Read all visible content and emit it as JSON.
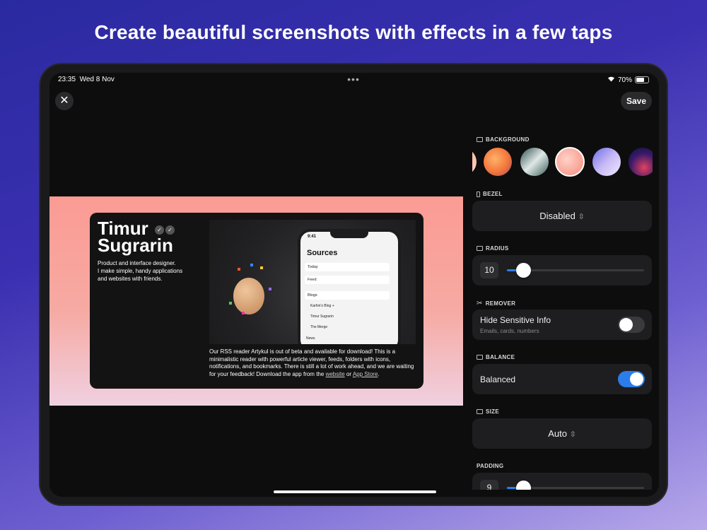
{
  "headline": "Create beautiful screenshots with effects in a few taps",
  "status_bar": {
    "time": "23:35",
    "date": "Wed 8 Nov",
    "battery": "70%",
    "battery_level": 0.7
  },
  "toolbar": {
    "close_icon": "close-icon",
    "save_label": "Save"
  },
  "card": {
    "title_line1": "Timur",
    "title_line2": "Sugrarin",
    "desc_line1": "Product and interface designer.",
    "desc_line2": "I make simple, handy applications",
    "desc_line3": "and websites with friends.",
    "body_text": "Our RSS reader Artykul is out of beta and available for download! This is a minimalistic reader with powerful article viewer, feeds, folders with icons, notifications, and bookmarks. There is still a lot of work ahead, and we are waiting for your feedback! Download the app from the",
    "link_website": "website",
    "or_text": "or",
    "link_appstore": "App Store",
    "period": "."
  },
  "phone": {
    "time": "9:41",
    "title": "Sources",
    "rows": [
      "Today",
      "Feed",
      "Blogs"
    ],
    "sub_rows": [
      "Karhin's Blog +",
      "Timur Sugrarin",
      "The Merge"
    ],
    "next_row": "News"
  },
  "panel": {
    "background": {
      "label": "BACKGROUND",
      "swatches": [
        "linear-gradient(135deg,#f7a68a,#fbd3c4)",
        "radial-gradient(circle at 40% 40%, #ffb36b, #f2763a 55%, #9c4a6a)",
        "linear-gradient(135deg,#2f4f4f,#dfe8e6 50%,#3b5e5a)",
        "radial-gradient(circle at 40% 40%, #ffd2c8, #f7877a)",
        "linear-gradient(135deg,#6c6ae8,#c7b9f5 50%,#efe9ff)",
        "radial-gradient(circle at 55% 70%, #e2415f, #3a1a6a 55%, #0d1240)",
        "linear-gradient(135deg,#f25c3a,#a21e3a)"
      ]
    },
    "bezel": {
      "label": "BEZEL",
      "value": "Disabled"
    },
    "radius": {
      "label": "RADIUS",
      "value": "10",
      "fraction": 0.12
    },
    "remover": {
      "label": "REMOVER",
      "title": "Hide Sensitive Info",
      "subtitle": "Emails, cards, numbers",
      "enabled": false
    },
    "balance": {
      "label": "BALANCE",
      "title": "Balanced",
      "enabled": true
    },
    "size": {
      "label": "SIZE",
      "value": "Auto"
    },
    "padding": {
      "label": "PADDING",
      "value": "9",
      "fraction": 0.12
    }
  }
}
